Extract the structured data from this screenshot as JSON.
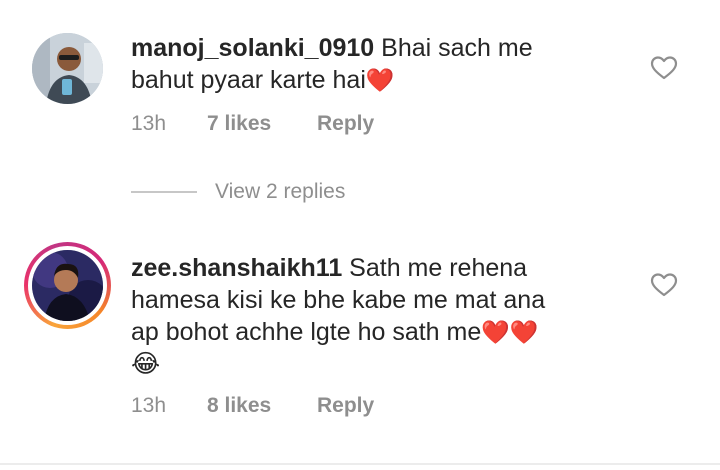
{
  "comments": [
    {
      "username": "manoj_solanki_0910",
      "text_line1": " Bhai sach me",
      "text_line2": "bahut pyaar karte hai",
      "heart": "❤️",
      "time": "13h",
      "likes": "7 likes",
      "reply_label": "Reply"
    },
    {
      "username": "zee.shanshaikh11",
      "text_line1": " Sath me rehena",
      "text_line2": "hamesa kisi ke bhe kabe me mat ana",
      "text_line3": "ap bohot achhe lgte ho sath me",
      "hearts": "❤️❤️",
      "emoji": "😂",
      "time": "13h",
      "likes": "8 likes",
      "reply_label": "Reply"
    }
  ],
  "view_replies": "View 2 replies",
  "icons": {
    "like": "heart-outline-icon",
    "avatar": "avatar"
  },
  "colors": {
    "text": "#262626",
    "secondary": "#8e8e8e",
    "heart": "#e0152c",
    "story_ring_start": "#f9a43a",
    "story_ring_end": "#c13584"
  }
}
